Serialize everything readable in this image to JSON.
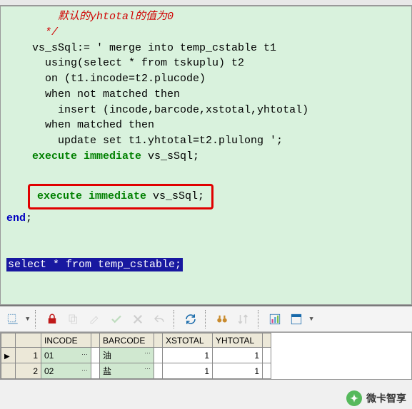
{
  "code": {
    "comment1": "默认的yhtotal的值为0",
    "comment2": "*/",
    "line_assign": "    vs_sSql:= ' merge into temp_cstable t1",
    "line_using": "      using(select * from tskuplu) t2",
    "line_on": "      on (t1.incode=t2.plucode)",
    "line_when1": "      when not matched then",
    "line_insert": "        insert (incode,barcode,xstotal,yhtotal)",
    "line_when2": "      when matched then",
    "line_update": "        update set t1.yhtotal=t2.plulong ';",
    "exec_kw": "execute immediate",
    "exec_arg": " vs_sSql;",
    "end_kw": "end",
    "end_semi": ";",
    "select_line": "select * from temp_cstable;"
  },
  "grid": {
    "headers": {
      "incode": "INCODE",
      "barcode": "BARCODE",
      "xstotal": "XSTOTAL",
      "yhtotal": "YHTOTAL"
    },
    "rows": [
      {
        "n": "1",
        "incode": "01",
        "barcode": "油",
        "xstotal": "1",
        "yhtotal": "1"
      },
      {
        "n": "2",
        "incode": "02",
        "barcode": "盐",
        "xstotal": "1",
        "yhtotal": "1"
      }
    ]
  },
  "watermark": "微卡智享"
}
